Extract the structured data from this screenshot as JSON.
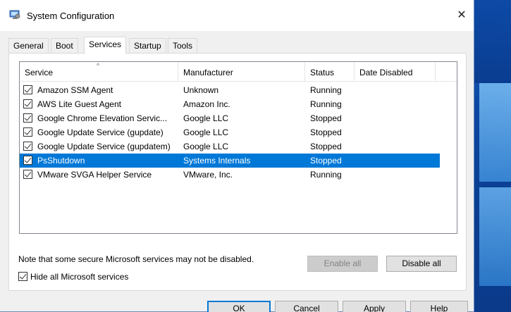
{
  "window": {
    "title": "System Configuration",
    "close_glyph": "✕"
  },
  "tabs": [
    {
      "label": "General"
    },
    {
      "label": "Boot"
    },
    {
      "label": "Services"
    },
    {
      "label": "Startup"
    },
    {
      "label": "Tools"
    }
  ],
  "active_tab": "Services",
  "table": {
    "columns": [
      "Service",
      "Manufacturer",
      "Status",
      "Date Disabled"
    ],
    "sort_indicator": "^",
    "rows": [
      {
        "checked": true,
        "service": "Amazon SSM Agent",
        "manufacturer": "Unknown",
        "status": "Running",
        "date_disabled": ""
      },
      {
        "checked": true,
        "service": "AWS Lite Guest Agent",
        "manufacturer": "Amazon Inc.",
        "status": "Running",
        "date_disabled": ""
      },
      {
        "checked": true,
        "service": "Google Chrome Elevation Servic...",
        "manufacturer": "Google LLC",
        "status": "Stopped",
        "date_disabled": ""
      },
      {
        "checked": true,
        "service": "Google Update Service (gupdate)",
        "manufacturer": "Google LLC",
        "status": "Stopped",
        "date_disabled": ""
      },
      {
        "checked": true,
        "service": "Google Update Service (gupdatem)",
        "manufacturer": "Google LLC",
        "status": "Stopped",
        "date_disabled": ""
      },
      {
        "checked": true,
        "service": "PsShutdown",
        "manufacturer": "Systems Internals",
        "status": "Stopped",
        "date_disabled": "",
        "selected": true
      },
      {
        "checked": true,
        "service": "VMware SVGA Helper Service",
        "manufacturer": "VMware, Inc.",
        "status": "Running",
        "date_disabled": ""
      }
    ]
  },
  "note": "Note that some secure Microsoft services may not be disabled.",
  "enable_all_label": "Enable all",
  "disable_all_label": "Disable all",
  "hide_ms": {
    "label": "Hide all Microsoft services",
    "checked": true
  },
  "footer": {
    "ok_label": "OK",
    "cancel_label": "Cancel",
    "apply_label": "Apply",
    "help_label": "Help"
  },
  "colors": {
    "selection": "#0078d7",
    "desktop": "#0d47a1"
  },
  "icons": {
    "app": "msconfig-icon",
    "close": "close-icon",
    "checkbox": "checkbox-checked-icon"
  }
}
